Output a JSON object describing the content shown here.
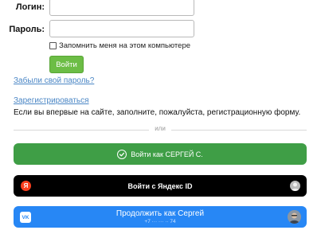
{
  "form": {
    "login_label": "Логин:",
    "login_value": "",
    "password_label": "Пароль:",
    "password_value": "",
    "remember_label": "Запомнить меня на этом компьютере",
    "remember_checked": false,
    "submit_label": "Войти"
  },
  "links": {
    "forgot": "Забыли свой пароль?",
    "register": "Зарегистрироваться"
  },
  "register_hint": "Если вы впервые на сайте, заполните, пожалуйста, регистрационную форму.",
  "divider_text": "или",
  "social": {
    "sber": {
      "label": "Войти как СЕРГЕЙ С.",
      "color": "#3f9e46",
      "icon": "check-circle-icon"
    },
    "yandex": {
      "label": "Войти с Яндекс ID",
      "color": "#000000",
      "logo": "Я",
      "icon": "yandex-logo-icon"
    },
    "vk": {
      "label": "Продолжить как Сергей",
      "phone": "+7 ··· ··· ·· 74",
      "logo": "VK",
      "color": "#2787f5",
      "icon": "vk-logo-icon"
    }
  }
}
